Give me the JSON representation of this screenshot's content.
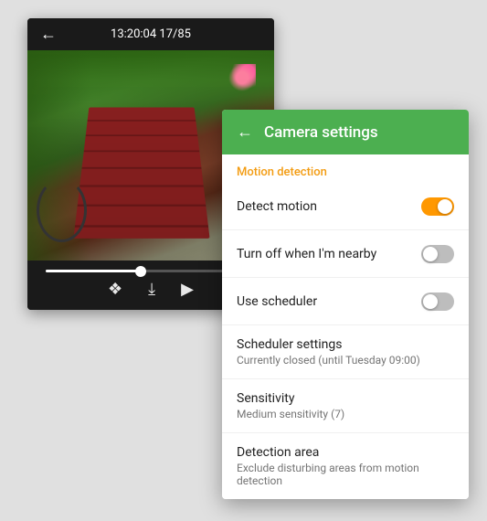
{
  "camera": {
    "topbar": {
      "back_label": "←",
      "time": "13:20:04",
      "counter": "17/85"
    },
    "controls": {
      "share_icon": "share",
      "download_icon": "download",
      "play_icon": "play"
    }
  },
  "settings": {
    "header": {
      "back_label": "←",
      "title": "Camera settings"
    },
    "section_label": "Motion detection",
    "rows": [
      {
        "title": "Detect motion",
        "subtitle": "",
        "has_toggle": true,
        "toggle_on": true
      },
      {
        "title": "Turn off when I'm nearby",
        "subtitle": "",
        "has_toggle": true,
        "toggle_on": false
      },
      {
        "title": "Use scheduler",
        "subtitle": "",
        "has_toggle": true,
        "toggle_on": false
      },
      {
        "title": "Scheduler settings",
        "subtitle": "Currently closed (until Tuesday 09:00)",
        "has_toggle": false,
        "toggle_on": false
      },
      {
        "title": "Sensitivity",
        "subtitle": "Medium sensitivity (7)",
        "has_toggle": false,
        "toggle_on": false
      },
      {
        "title": "Detection area",
        "subtitle": "Exclude disturbing areas from motion detection",
        "has_toggle": false,
        "toggle_on": false
      }
    ]
  }
}
